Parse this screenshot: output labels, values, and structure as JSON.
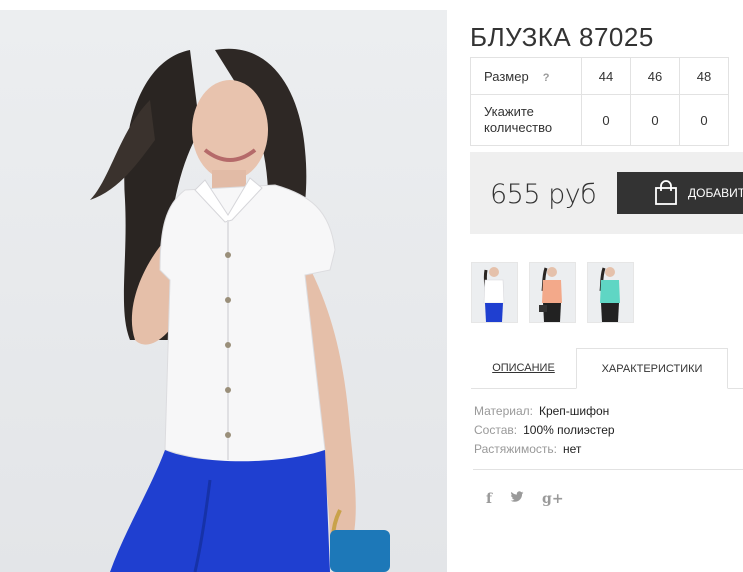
{
  "product": {
    "title": "БЛУЗКА 87025",
    "price": "655 руб",
    "add_to_cart_label": "ДОБАВИТЬ"
  },
  "size_table": {
    "size_label": "Размер",
    "help_mark": "?",
    "sizes": [
      "44",
      "46",
      "48"
    ],
    "quantity_label_line1": "Укажите",
    "quantity_label_line2": "количество",
    "quantities": [
      "0",
      "0",
      "0"
    ]
  },
  "thumbnails": [
    {
      "label": "white blouse"
    },
    {
      "label": "peach blouse"
    },
    {
      "label": "mint blouse"
    }
  ],
  "tabs": {
    "description_label": "ОПИСАНИЕ",
    "characteristics_label": "ХАРАКТЕРИСТИКИ",
    "active": "characteristics"
  },
  "specs": [
    {
      "key": "Материал:",
      "value": "Креп-шифон"
    },
    {
      "key": "Состав:",
      "value": "100% полиэстер"
    },
    {
      "key": "Растяжимость:",
      "value": "нет"
    }
  ],
  "social": {
    "facebook": "f",
    "twitter": "twitter-icon",
    "google_plus": "g+"
  },
  "colors": {
    "button_bg": "#333333",
    "price_box_bg": "#efefef",
    "border": "#e2e2e2",
    "muted_text": "#999999"
  }
}
